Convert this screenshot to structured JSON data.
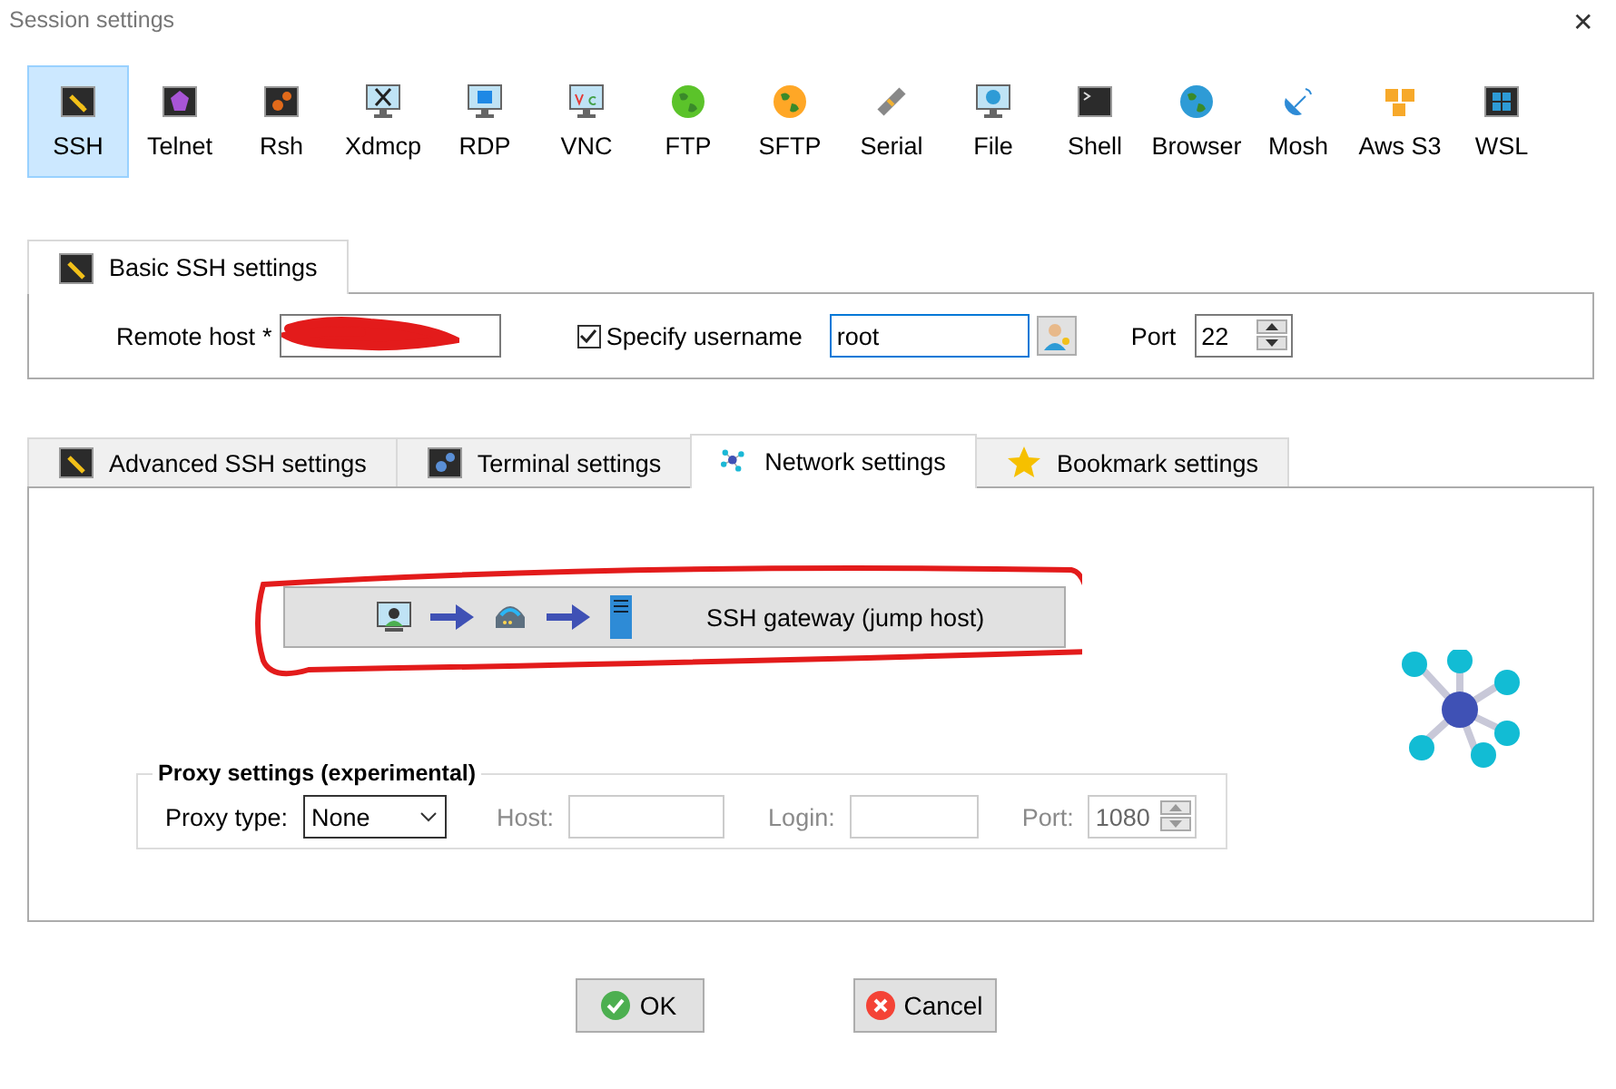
{
  "window": {
    "title": "Session settings",
    "close": "✕"
  },
  "session_types": [
    {
      "label": "SSH",
      "selected": true
    },
    {
      "label": "Telnet",
      "selected": false
    },
    {
      "label": "Rsh",
      "selected": false
    },
    {
      "label": "Xdmcp",
      "selected": false
    },
    {
      "label": "RDP",
      "selected": false
    },
    {
      "label": "VNC",
      "selected": false
    },
    {
      "label": "FTP",
      "selected": false
    },
    {
      "label": "SFTP",
      "selected": false
    },
    {
      "label": "Serial",
      "selected": false
    },
    {
      "label": "File",
      "selected": false
    },
    {
      "label": "Shell",
      "selected": false
    },
    {
      "label": "Browser",
      "selected": false
    },
    {
      "label": "Mosh",
      "selected": false
    },
    {
      "label": "Aws S3",
      "selected": false
    },
    {
      "label": "WSL",
      "selected": false
    }
  ],
  "basic": {
    "tab": "Basic SSH settings",
    "remote_host_label": "Remote host",
    "required_mark": "*",
    "specify_username": {
      "label": "Specify username",
      "checked": true
    },
    "username": "root",
    "port_label": "Port",
    "port": "22"
  },
  "tabs": [
    {
      "label": "Advanced SSH settings",
      "selected": false
    },
    {
      "label": "Terminal settings",
      "selected": false
    },
    {
      "label": "Network settings",
      "selected": true
    },
    {
      "label": "Bookmark settings",
      "selected": false
    }
  ],
  "network": {
    "gateway_button": "SSH gateway (jump host)",
    "proxy": {
      "legend": "Proxy settings (experimental)",
      "type_label": "Proxy type:",
      "type": "None",
      "host_label": "Host:",
      "login_label": "Login:",
      "port_label": "Port:",
      "port": "1080",
      "disabled": true
    }
  },
  "buttons": [
    {
      "label": "OK",
      "kind": "ok"
    },
    {
      "label": "Cancel",
      "kind": "cancel"
    }
  ]
}
